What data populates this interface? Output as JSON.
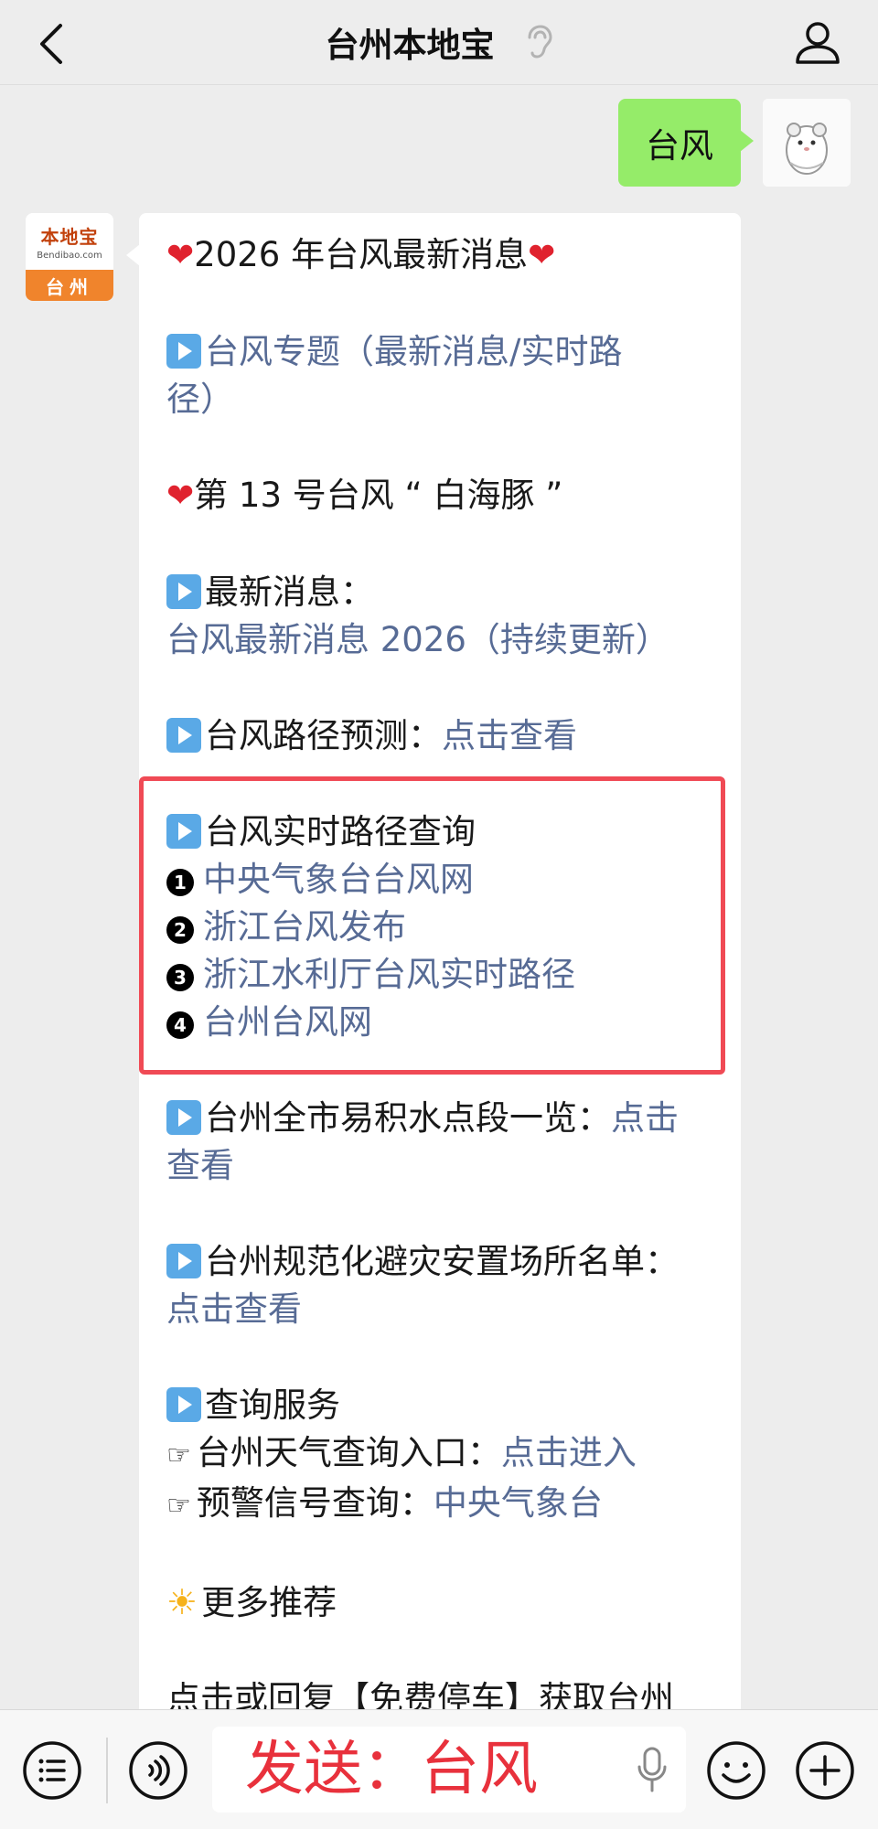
{
  "header": {
    "title": "台州本地宝",
    "back_icon": "chevron-left-icon",
    "profile_icon": "person-icon"
  },
  "outgoing": {
    "text": "台风"
  },
  "bot": {
    "avatar_main": "本地宝",
    "avatar_sub": "Bendibao.com",
    "avatar_city": "台州"
  },
  "message": {
    "heading": "2026 年台风最新消息",
    "topic_link_1": "台风专题（最新消息/实时路",
    "topic_link_2": "径）",
    "typhoon_name": "第 13 号台风 “ 白海豚 ”",
    "latest_label": "最新消息：",
    "latest_link": "台风最新消息 2026（持续更新）",
    "forecast_label": "台风路径预测：",
    "forecast_link": "点击查看",
    "realtime_label": "台风实时路径查询",
    "realtime_links": [
      "中央气象台台风网",
      "浙江台风发布",
      "浙江水利厅台风实时路径",
      "台州台风网"
    ],
    "realtime_nums": [
      "1",
      "2",
      "3",
      "4"
    ],
    "waterlog_label": "台州全市易积水点段一览：",
    "waterlog_link_1": "点击",
    "waterlog_link_2": "查看",
    "shelter_label": "台州规范化避灾安置场所名单：",
    "shelter_link": "点击查看",
    "service_label": "查询服务",
    "weather_label": "台州天气查询入口：",
    "weather_link": "点击进入",
    "warning_label": "预警信号查询：",
    "warning_link": "中央气象台",
    "more_label": "更多推荐",
    "cut_line": "点击或回复【免费停车】获取台州"
  },
  "bottom": {
    "input_text": "发送：台风",
    "menu_icon": "list-menu-icon",
    "voice_icon": "voice-icon",
    "mic_icon": "microphone-icon",
    "emoji_icon": "emoji-icon",
    "plus_icon": "plus-icon"
  },
  "colors": {
    "link": "#576b95",
    "bubble_out": "#95ec69",
    "highlight": "#f04a55",
    "input_text": "#e8313c"
  }
}
